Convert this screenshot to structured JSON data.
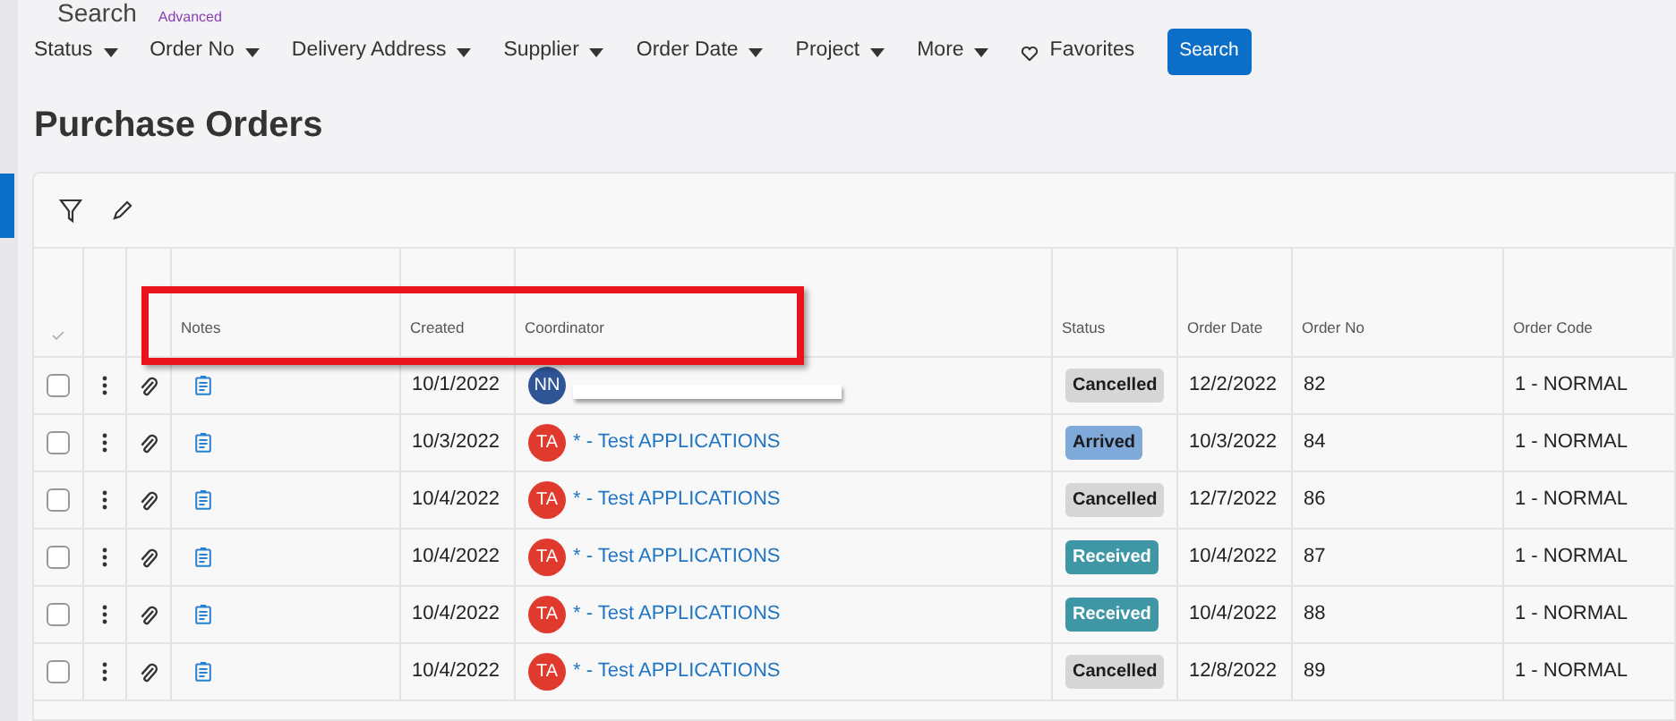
{
  "header": {
    "title": "Search",
    "link": "Advanced"
  },
  "filters": [
    {
      "label": "Status"
    },
    {
      "label": "Order No"
    },
    {
      "label": "Delivery Address"
    },
    {
      "label": "Supplier"
    },
    {
      "label": "Order Date"
    },
    {
      "label": "Project"
    },
    {
      "label": "More"
    }
  ],
  "favorites": "Favorites",
  "search_button": "Search",
  "page_title": "Purchase Orders",
  "table": {
    "columns": [
      "Notes",
      "Created",
      "Coordinator",
      "Status",
      "Order Date",
      "Order No",
      "Order Code"
    ],
    "rows": [
      {
        "checked": false,
        "created": "10/1/2022",
        "avatar": {
          "initials": "NN",
          "color": "#2f5597"
        },
        "redacted": true,
        "status": {
          "label": "Cancelled",
          "color": "#d6d6d6"
        },
        "order_date": "12/2/2022",
        "order_no": "82",
        "order_code": "1 - NORMAL"
      },
      {
        "checked": false,
        "created": "10/3/2022",
        "avatar": {
          "initials": "TA",
          "color": "#e03a2e"
        },
        "coordinator": "* - Test APPLICATIONS",
        "redacted": false,
        "status": {
          "label": "Arrived",
          "color": "#7fa9d8"
        },
        "order_date": "10/3/2022",
        "order_no": "84",
        "order_code": "1 - NORMAL"
      },
      {
        "checked": false,
        "created": "10/4/2022",
        "avatar": {
          "initials": "TA",
          "color": "#e03a2e"
        },
        "coordinator": "* - Test APPLICATIONS",
        "redacted": false,
        "status": {
          "label": "Cancelled",
          "color": "#d6d6d6"
        },
        "order_date": "12/7/2022",
        "order_no": "86",
        "order_code": "1 - NORMAL"
      },
      {
        "checked": false,
        "created": "10/4/2022",
        "avatar": {
          "initials": "TA",
          "color": "#e03a2e"
        },
        "coordinator": "* - Test APPLICATIONS",
        "redacted": false,
        "status": {
          "label": "Received",
          "color": "#3f97a5"
        },
        "order_date": "10/4/2022",
        "order_no": "87",
        "order_code": "1 - NORMAL"
      },
      {
        "checked": false,
        "created": "10/4/2022",
        "avatar": {
          "initials": "TA",
          "color": "#e03a2e"
        },
        "coordinator": "* - Test APPLICATIONS",
        "redacted": false,
        "status": {
          "label": "Received",
          "color": "#3f97a5"
        },
        "order_date": "10/4/2022",
        "order_no": "88",
        "order_code": "1 - NORMAL"
      },
      {
        "checked": false,
        "created": "10/4/2022",
        "avatar": {
          "initials": "TA",
          "color": "#e03a2e"
        },
        "coordinator": "* - Test APPLICATIONS",
        "redacted": false,
        "status": {
          "label": "Cancelled",
          "color": "#d6d6d6"
        },
        "order_date": "12/8/2022",
        "order_no": "89",
        "order_code": "1 - NORMAL"
      }
    ]
  }
}
